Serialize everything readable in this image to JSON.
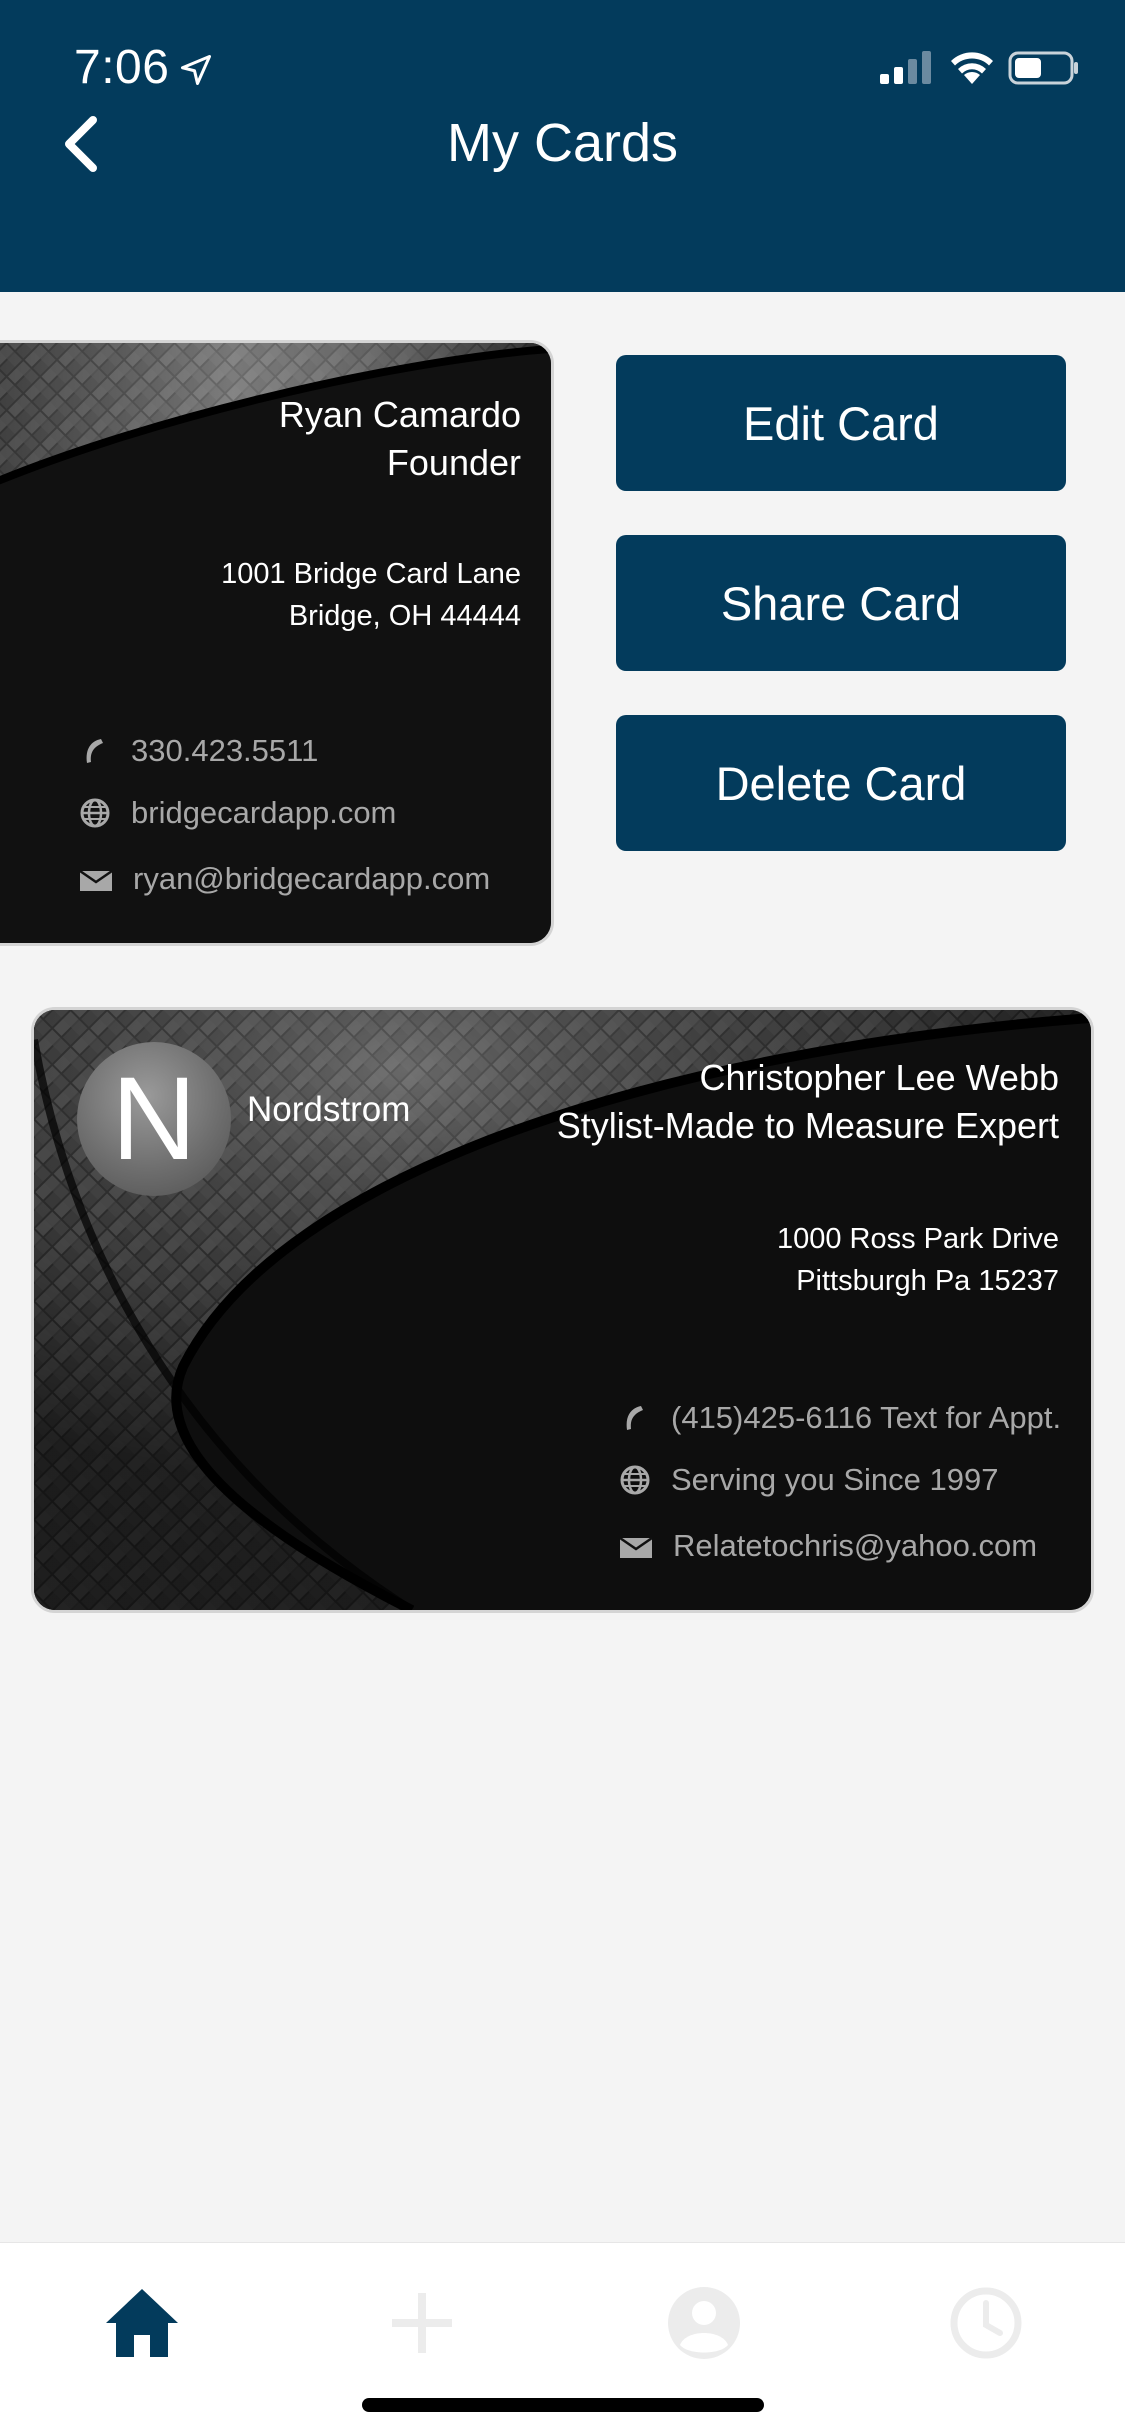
{
  "status_bar": {
    "time": "7:06"
  },
  "header": {
    "title": "My Cards"
  },
  "cards": [
    {
      "name": "Ryan Camardo",
      "title": "Founder",
      "address_line1": "1001 Bridge Card Lane",
      "address_line2": "Bridge, OH 44444",
      "phone": "330.423.5511",
      "website": "bridgecardapp.com",
      "email": "ryan@bridgecardapp.com"
    },
    {
      "avatar_letter": "N",
      "company": "Nordstrom",
      "name": "Christopher Lee Webb",
      "title": "Stylist-Made to Measure Expert",
      "address_line1": "1000 Ross Park Drive",
      "address_line2": "Pittsburgh Pa 15237",
      "phone": "(415)425-6116 Text for Appt.",
      "website": "Serving you Since 1997",
      "email": "Relatetochris@yahoo.com"
    }
  ],
  "actions": {
    "edit": "Edit Card",
    "share": "Share Card",
    "delete": "Delete Card"
  },
  "tabbar": {
    "tabs": [
      {
        "icon": "home-icon",
        "active": true
      },
      {
        "icon": "plus-icon",
        "active": false
      },
      {
        "icon": "profile-icon",
        "active": false
      },
      {
        "icon": "clock-icon",
        "active": false
      }
    ]
  },
  "colors": {
    "primary": "#033b5c",
    "background": "#f4f4f4",
    "card_background": "#111111",
    "contact_text": "#a8a8a8",
    "inactive_tab": "#ececec"
  }
}
